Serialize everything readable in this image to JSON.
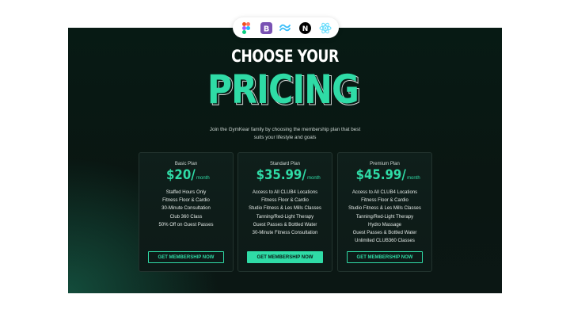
{
  "badges": [
    {
      "name": "figma-icon"
    },
    {
      "name": "bootstrap-icon"
    },
    {
      "name": "tailwind-icon"
    },
    {
      "name": "nextjs-icon"
    },
    {
      "name": "react-icon"
    }
  ],
  "hero": {
    "headline": "CHOOSE YOUR",
    "title": "PRICING",
    "subtitle": "Join the GymKear family by choosing the membership plan that best suits your lifestyle and goals"
  },
  "colors": {
    "accent": "#2fdba6",
    "background": "#0a1612",
    "card": "#0f1f1b"
  },
  "plans": [
    {
      "name": "Basic Plan",
      "price": "$20/",
      "period": "month",
      "features": [
        "Staffed Hours Only",
        "Fitness Floor & Cardio",
        "30-Minute Consultation",
        "Club 360 Class",
        "50% Off on Guest Passes"
      ],
      "cta": "GET MEMBERSHIP NOW",
      "highlighted": false
    },
    {
      "name": "Standard Plan",
      "price": "$35.99/",
      "period": "month",
      "features": [
        "Access to All CLUB4 Locations",
        "Fitness Floor & Cardio",
        "Studio Fitness & Les Mills Classes",
        "Tanning/Red-Light Therapy",
        "Guest Passes & Bottled Water",
        "30-Minute Fitness Consultation"
      ],
      "cta": "GET MEMBERSHIP NOW",
      "highlighted": true
    },
    {
      "name": "Premium Plan",
      "price": "$45.99/",
      "period": "month",
      "features": [
        "Access to All CLUB4 Locations",
        "Fitness Floor & Cardio",
        "Studio Fitness & Les Mills Classes",
        "Tanning/Red-Light Therapy",
        "Hydro Massage",
        "Guest Passes & Bottled Water",
        "Unlimited CLUB360 Classes"
      ],
      "cta": "GET MEMBERSHIP NOW",
      "highlighted": false
    }
  ]
}
